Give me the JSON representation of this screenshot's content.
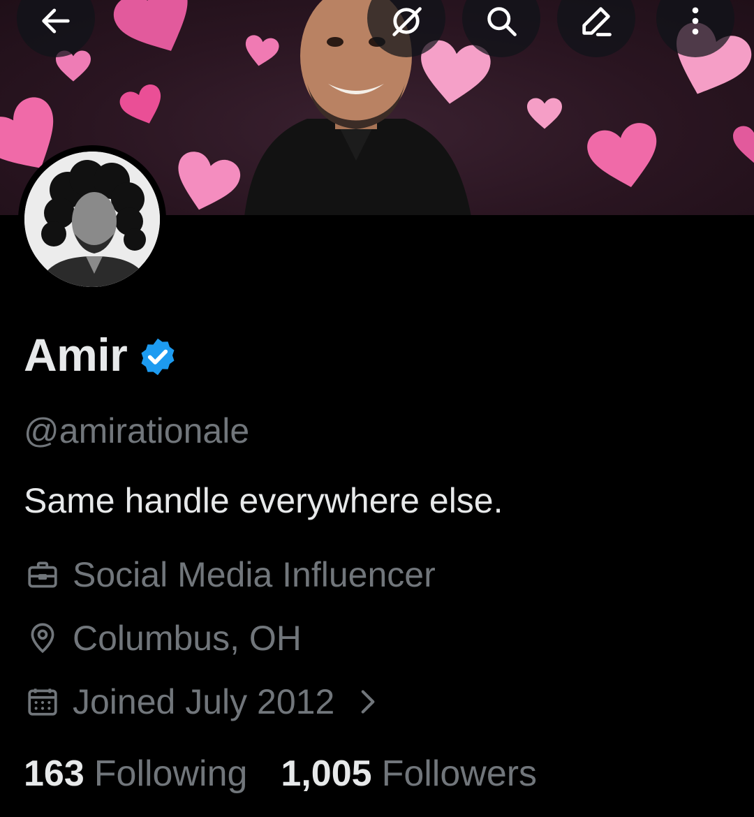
{
  "header": {
    "back_icon": "arrow-left-icon",
    "actions": [
      "grok-icon",
      "search-icon",
      "edit-icon",
      "more-vertical-icon"
    ]
  },
  "profile": {
    "display_name": "Amir",
    "verified": true,
    "handle": "@amirationale",
    "bio": "Same handle everywhere else.",
    "category": "Social Media Influencer",
    "location": "Columbus, OH",
    "joined": "Joined July 2012"
  },
  "stats": {
    "following_count": "163",
    "following_label": "Following",
    "followers_count": "1,005",
    "followers_label": "Followers"
  },
  "colors": {
    "background": "#000000",
    "primary_text": "#e7e9ea",
    "secondary_text": "#71767b",
    "verified_blue": "#1d9bf0",
    "heart_pink": "#f06aa8",
    "banner_bg": "#2a1521"
  }
}
